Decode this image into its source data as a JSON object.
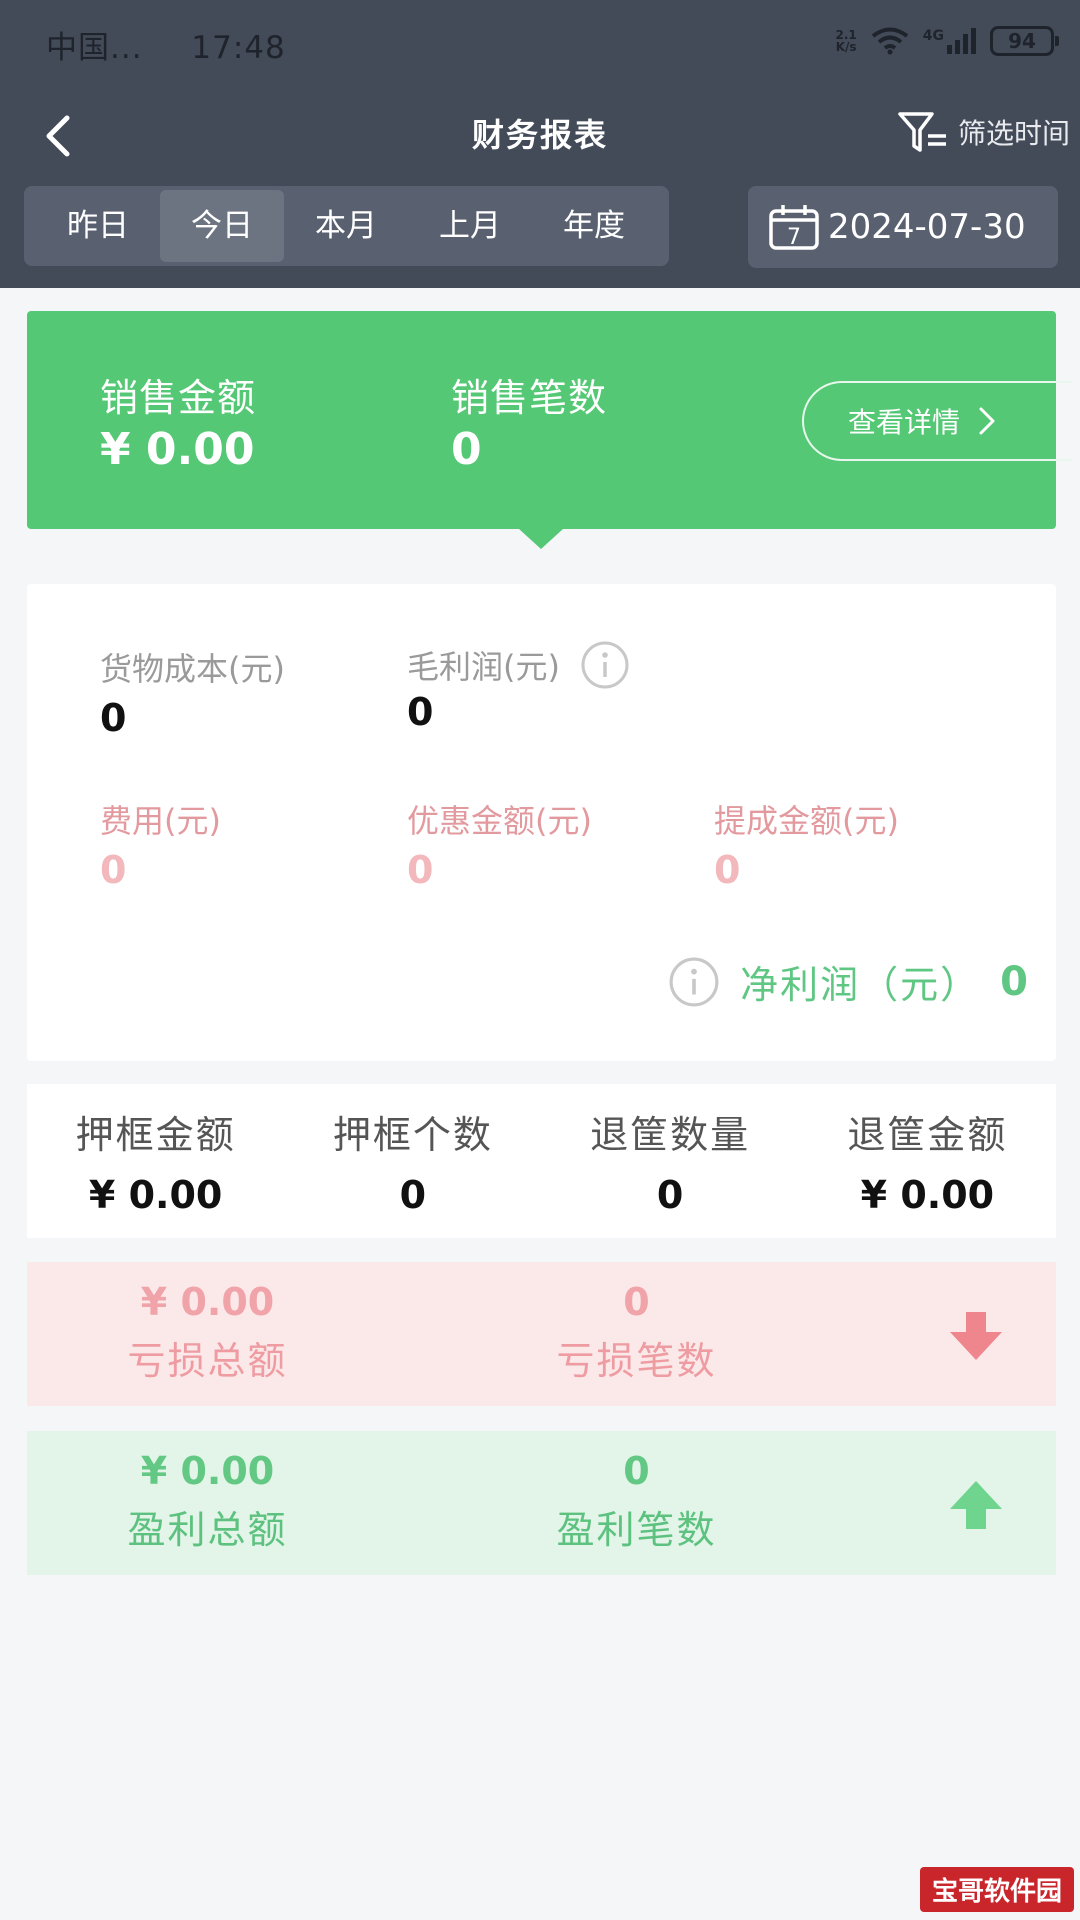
{
  "status_bar": {
    "carrier": "中国...",
    "time": "17:48",
    "speed_top": "2.1",
    "speed_bottom": "K/s",
    "network": "4G",
    "battery": "94"
  },
  "nav": {
    "title": "财务报表",
    "filter_label": "筛选时间"
  },
  "tabs": [
    {
      "label": "昨日",
      "active": false
    },
    {
      "label": "今日",
      "active": true
    },
    {
      "label": "本月",
      "active": false
    },
    {
      "label": "上月",
      "active": false
    },
    {
      "label": "年度",
      "active": false
    }
  ],
  "date": {
    "calendar_day": "7",
    "value": "2024-07-30"
  },
  "sales": {
    "amount_label": "销售金额",
    "amount_value": "¥ 0.00",
    "count_label": "销售笔数",
    "count_value": "0",
    "detail_button": "查看详情"
  },
  "profit": {
    "cost_label": "货物成本(元)",
    "cost_value": "0",
    "gross_label": "毛利润(元)",
    "gross_value": "0",
    "expense_label": "费用(元)",
    "expense_value": "0",
    "discount_label": "优惠金额(元)",
    "discount_value": "0",
    "commission_label": "提成金额(元)",
    "commission_value": "0",
    "net_label": "净利润（元）",
    "net_value": "0"
  },
  "deposit": [
    {
      "label": "押框金额",
      "value": "¥ 0.00"
    },
    {
      "label": "押框个数",
      "value": "0"
    },
    {
      "label": "退筐数量",
      "value": "0"
    },
    {
      "label": "退筐金额",
      "value": "¥ 0.00"
    }
  ],
  "loss": {
    "total_value": "¥ 0.00",
    "total_label": "亏损总额",
    "count_value": "0",
    "count_label": "亏损笔数"
  },
  "gain": {
    "total_value": "¥ 0.00",
    "total_label": "盈利总额",
    "count_value": "0",
    "count_label": "盈利笔数"
  },
  "watermark": "宝哥软件园",
  "colors": {
    "header_bg": "#434a58",
    "sales_green": "#55c875",
    "loss_bg": "#fbe9ea",
    "gain_bg": "#e3f4e8",
    "loss_arrow": "#f0868d",
    "gain_arrow": "#6ed48e"
  }
}
